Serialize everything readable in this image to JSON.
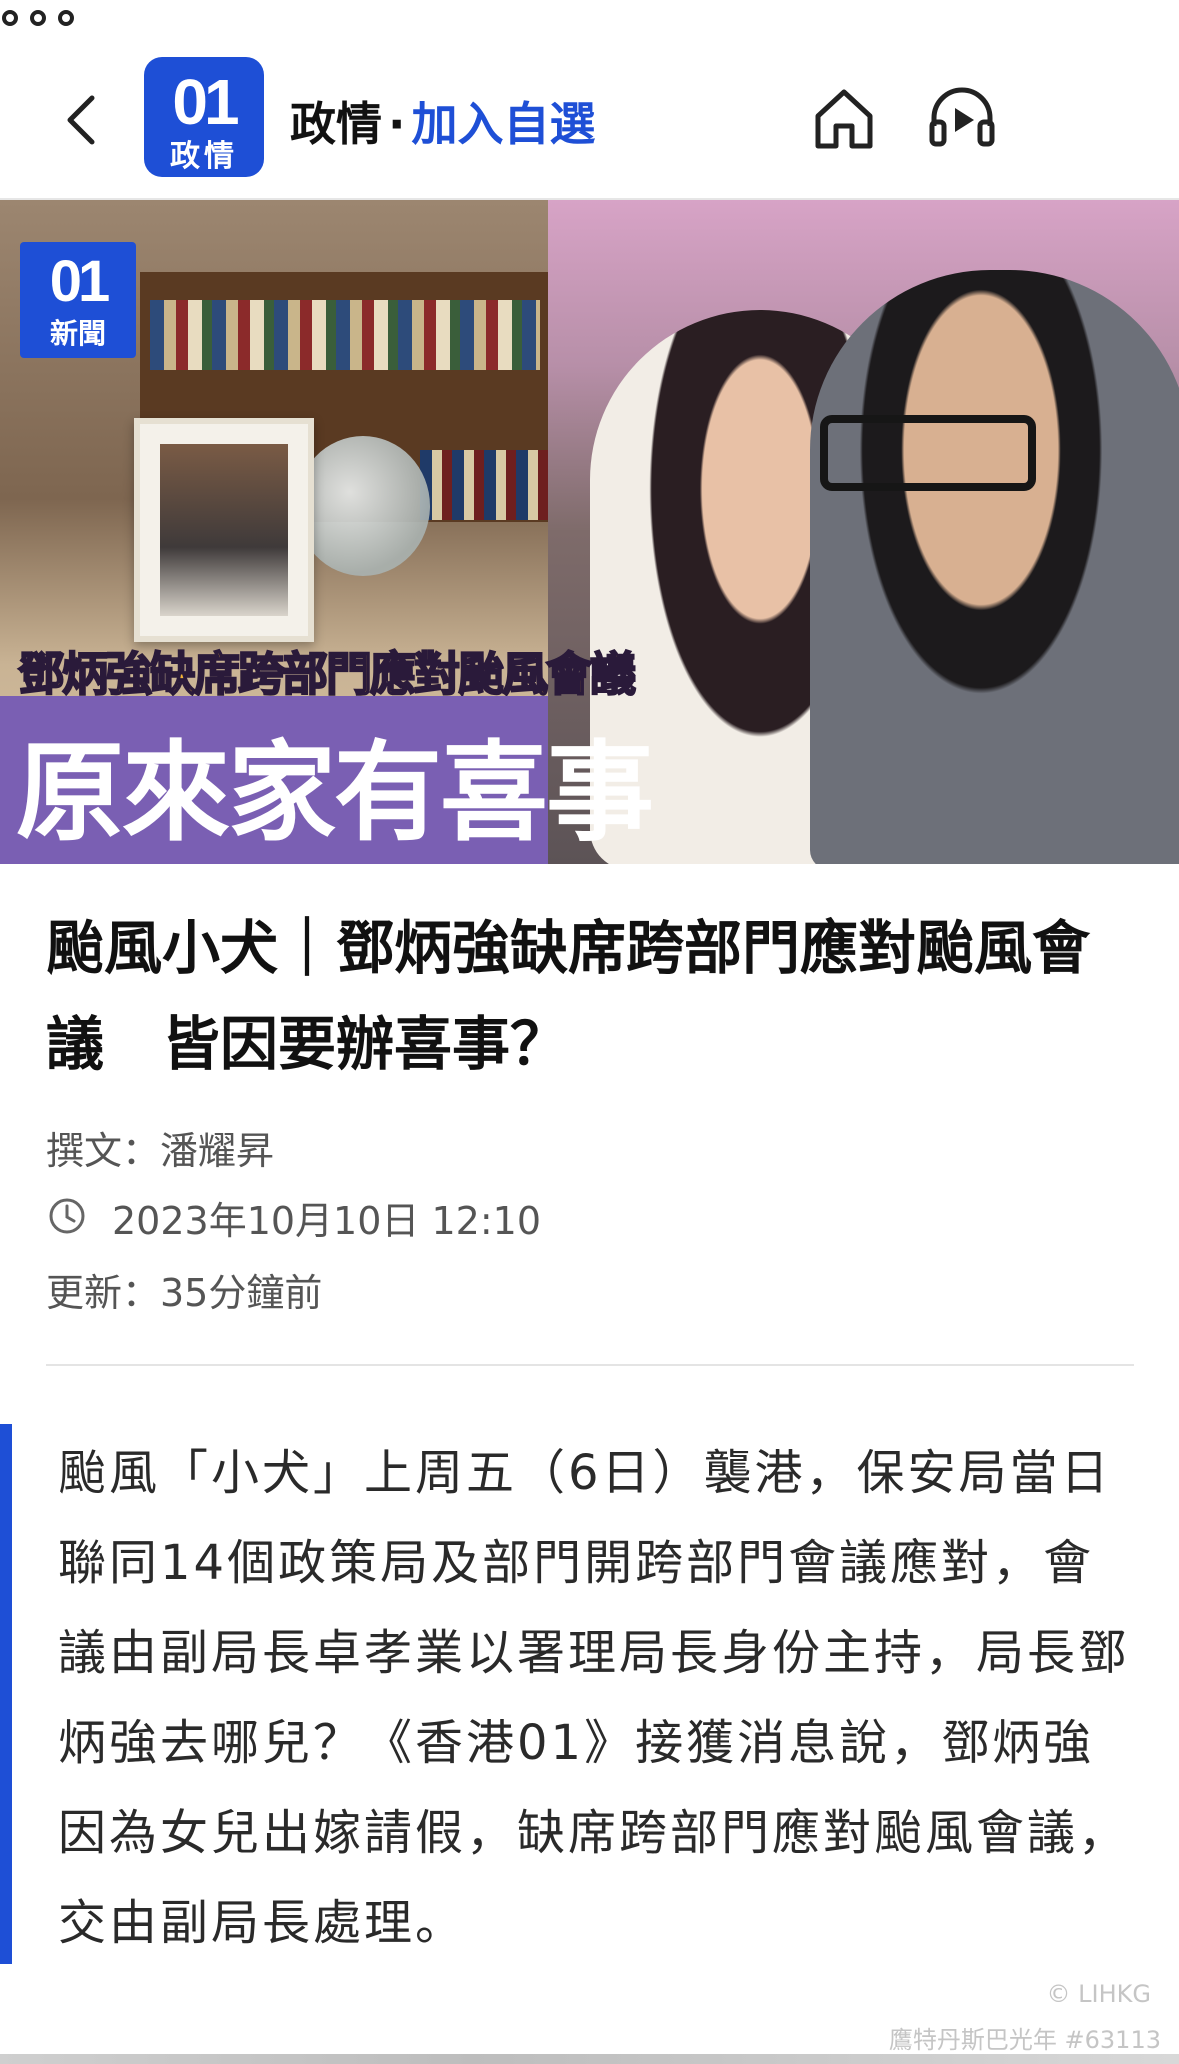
{
  "header": {
    "logo_number": "01",
    "logo_label": "政情",
    "section": "政情",
    "separator": "·",
    "follow_label": "加入自選",
    "icons": [
      "back-icon",
      "home-icon",
      "audio-icon",
      "more-icon"
    ]
  },
  "hero": {
    "badge_number": "01",
    "badge_label": "新聞",
    "caption_line1": "鄧炳強缺席跨部門應對颱風會議",
    "caption_line2": "原來家有喜事"
  },
  "article": {
    "title": "颱風小犬｜鄧炳強缺席跨部門應對颱風會議　皆因要辦喜事？",
    "author": "撰文：潘耀昇",
    "date": "2023年10月10日 12:10",
    "updated": "更新：35分鐘前",
    "body": "颱風「小犬」上周五（6日）襲港，保安局當日聯同14個政策局及部門開跨部門會議應對，會議由副局長卓孝業以署理局長身份主持，局長鄧炳強去哪兒？《香港01》接獲消息說，鄧炳強因為女兒出嫁請假，缺席跨部門應對颱風會議，交由副局長處理。"
  },
  "watermark": {
    "line1": "© LIHKG",
    "line2": "鷹特丹斯巴光年 #63113"
  },
  "colors": {
    "accent": "#1e4fd6",
    "caption_yellow": "#f4b537",
    "caption_purple": "#7a5fb3"
  }
}
